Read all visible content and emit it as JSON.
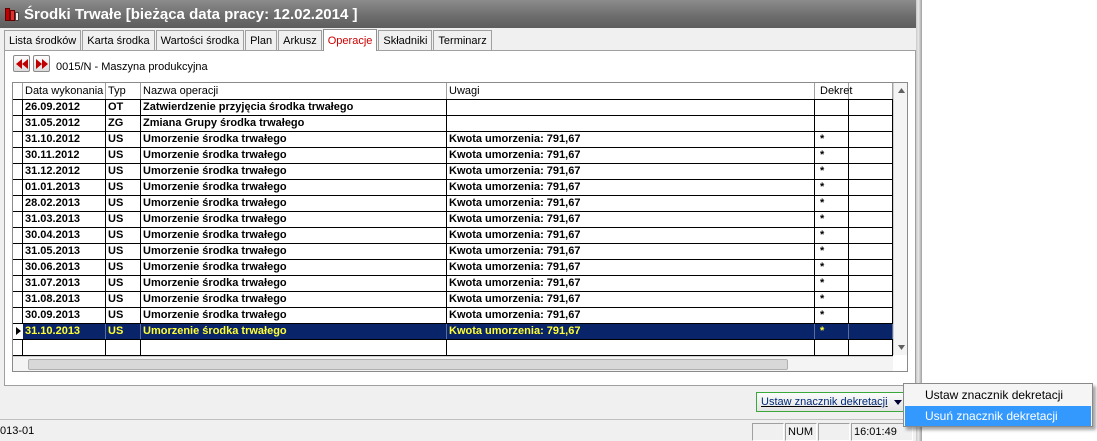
{
  "window": {
    "title": "Środki Trwałe  [bieżąca data pracy: 12.02.2014 ]"
  },
  "tabs": [
    {
      "label": "Lista środków",
      "active": false
    },
    {
      "label": "Karta środka",
      "active": false
    },
    {
      "label": "Wartości środka",
      "active": false
    },
    {
      "label": "Plan",
      "active": false
    },
    {
      "label": "Arkusz",
      "active": false
    },
    {
      "label": "Operacje",
      "active": true
    },
    {
      "label": "Składniki",
      "active": false
    },
    {
      "label": "Terminarz",
      "active": false
    }
  ],
  "asset": {
    "label": "0015/N - Maszyna produkcyjna"
  },
  "grid": {
    "columns": {
      "date": "Data wykonania",
      "typ": "Typ",
      "name": "Nazwa operacji",
      "uwagi": "Uwagi",
      "dekret": "Dekret"
    },
    "rows": [
      {
        "date": "26.09.2012",
        "typ": "OT",
        "name": "Zatwierdzenie przyjęcia środka trwałego",
        "uwagi": "",
        "dekret": ""
      },
      {
        "date": "31.05.2012",
        "typ": "ZG",
        "name": "Zmiana Grupy środka trwałego",
        "uwagi": "",
        "dekret": ""
      },
      {
        "date": "31.10.2012",
        "typ": "US",
        "name": "Umorzenie środka trwałego",
        "uwagi": "Kwota umorzenia: 791,67",
        "dekret": "*"
      },
      {
        "date": "30.11.2012",
        "typ": "US",
        "name": "Umorzenie środka trwałego",
        "uwagi": "Kwota umorzenia: 791,67",
        "dekret": "*"
      },
      {
        "date": "31.12.2012",
        "typ": "US",
        "name": "Umorzenie środka trwałego",
        "uwagi": "Kwota umorzenia: 791,67",
        "dekret": "*"
      },
      {
        "date": "01.01.2013",
        "typ": "US",
        "name": "Umorzenie środka trwałego",
        "uwagi": "Kwota umorzenia: 791,67",
        "dekret": "*"
      },
      {
        "date": "28.02.2013",
        "typ": "US",
        "name": "Umorzenie środka trwałego",
        "uwagi": "Kwota umorzenia: 791,67",
        "dekret": "*"
      },
      {
        "date": "31.03.2013",
        "typ": "US",
        "name": "Umorzenie środka trwałego",
        "uwagi": "Kwota umorzenia: 791,67",
        "dekret": "*"
      },
      {
        "date": "30.04.2013",
        "typ": "US",
        "name": "Umorzenie środka trwałego",
        "uwagi": "Kwota umorzenia: 791,67",
        "dekret": "*"
      },
      {
        "date": "31.05.2013",
        "typ": "US",
        "name": "Umorzenie środka trwałego",
        "uwagi": "Kwota umorzenia: 791,67",
        "dekret": "*"
      },
      {
        "date": "30.06.2013",
        "typ": "US",
        "name": "Umorzenie środka trwałego",
        "uwagi": "Kwota umorzenia: 791,67",
        "dekret": "*"
      },
      {
        "date": "31.07.2013",
        "typ": "US",
        "name": "Umorzenie środka trwałego",
        "uwagi": "Kwota umorzenia: 791,67",
        "dekret": "*"
      },
      {
        "date": "31.08.2013",
        "typ": "US",
        "name": "Umorzenie środka trwałego",
        "uwagi": "Kwota umorzenia: 791,67",
        "dekret": "*"
      },
      {
        "date": "30.09.2013",
        "typ": "US",
        "name": "Umorzenie środka trwałego",
        "uwagi": "Kwota umorzenia: 791,67",
        "dekret": "*"
      },
      {
        "date": "31.10.2013",
        "typ": "US",
        "name": "Umorzenie środka trwałego",
        "uwagi": "Kwota umorzenia: 791,67",
        "dekret": "*",
        "selected": true
      }
    ],
    "selected_row_bg": "#0a246a",
    "selected_row_fg": "#ffff33"
  },
  "dekret_menu": {
    "button_label": "Ustaw znacznik dekretacji",
    "items": [
      {
        "label": "Ustaw znacznik dekretacji",
        "highlighted": false
      },
      {
        "label": "Usuń znacznik dekretacji",
        "highlighted": true
      }
    ],
    "highlight_color": "#3399ff"
  },
  "statusbar": {
    "left_text": "013-01",
    "num": "NUM",
    "time": "16:01:49"
  }
}
